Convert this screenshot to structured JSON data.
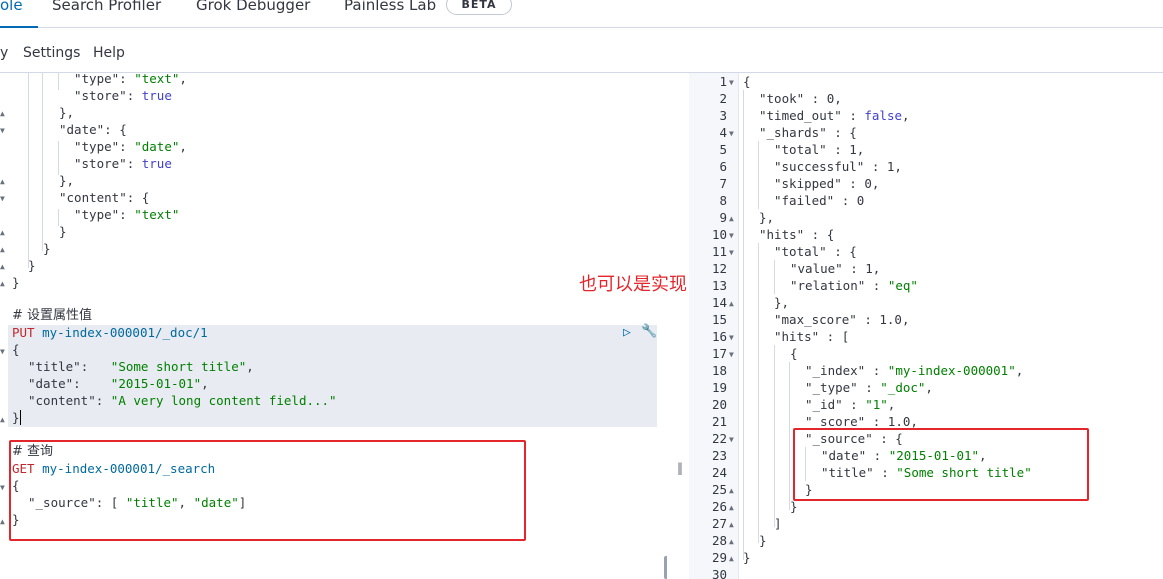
{
  "tabs": {
    "console": "ole",
    "search_profiler": "Search Profiler",
    "grok_debugger": "Grok Debugger",
    "painless_lab": "Painless Lab",
    "beta_badge": "BETA"
  },
  "menu": {
    "history": "y",
    "settings": "Settings",
    "help": "Help"
  },
  "accent_color": "#006bb4",
  "annotation_color": "#e3262b",
  "left_editor": {
    "lines": [
      {
        "a": "\"type\"",
        "b": ": ",
        "c": "\"text\"",
        "d": ","
      },
      {
        "a": "\"store\"",
        "b": ": ",
        "c": "true",
        "d": ""
      },
      {
        "a": "},",
        "b": "",
        "c": "",
        "d": ""
      },
      {
        "a": "\"date\"",
        "b": ": {",
        "c": "",
        "d": ""
      },
      {
        "a": "\"type\"",
        "b": ": ",
        "c": "\"date\"",
        "d": ","
      },
      {
        "a": "\"store\"",
        "b": ": ",
        "c": "true",
        "d": ""
      },
      {
        "a": "},",
        "b": "",
        "c": "",
        "d": ""
      },
      {
        "a": "\"content\"",
        "b": ": {",
        "c": "",
        "d": ""
      },
      {
        "a": "\"type\"",
        "b": ": ",
        "c": "\"text\"",
        "d": ""
      },
      {
        "a": "}",
        "b": "",
        "c": "",
        "d": ""
      },
      {
        "a": "}",
        "b": "",
        "c": "",
        "d": ""
      },
      {
        "a": "}",
        "b": "",
        "c": "",
        "d": ""
      },
      {
        "a": "}",
        "b": "",
        "c": "",
        "d": ""
      }
    ],
    "comment1": "# 设置属性值",
    "put_method": "PUT",
    "put_url": "my-index-000001/_doc/1",
    "body_open": "{",
    "title_key": "\"title\"",
    "title_sep": ":   ",
    "title_val": "\"Some short title\"",
    "date_key": "\"date\"",
    "date_sep": ":    ",
    "date_val": "\"2015-01-01\"",
    "content_key": "\"content\"",
    "content_sep": ": ",
    "content_val": "\"A very long content field...\"",
    "body_close": "}",
    "comment2": "# 查询",
    "get_method": "GET",
    "get_url": "my-index-000001/_search",
    "get_open": "{",
    "source_key": "\"_source\"",
    "source_sep": ": [ ",
    "source_v1": "\"title\"",
    "source_comma": ", ",
    "source_v2": "\"date\"",
    "source_end": "]",
    "get_close": "}"
  },
  "annotation_text": "也可以是实现",
  "right_editor": {
    "line_numbers": [
      "1",
      "2",
      "3",
      "4",
      "5",
      "6",
      "7",
      "8",
      "9",
      "10",
      "11",
      "12",
      "13",
      "14",
      "15",
      "16",
      "17",
      "18",
      "19",
      "20",
      "21",
      "22",
      "23",
      "24",
      "25",
      "26",
      "27",
      "28",
      "29",
      "30"
    ],
    "l1": "{",
    "l2k": "\"took\"",
    "l2v": "0",
    "l3k": "\"timed_out\"",
    "l3v": "false",
    "l4k": "\"_shards\"",
    "l5k": "\"total\"",
    "l5v": "1",
    "l6k": "\"successful\"",
    "l6v": "1",
    "l7k": "\"skipped\"",
    "l7v": "0",
    "l8k": "\"failed\"",
    "l8v": "0",
    "l9": "},",
    "l10k": "\"hits\"",
    "l11k": "\"total\"",
    "l12k": "\"value\"",
    "l12v": "1",
    "l13k": "\"relation\"",
    "l13v": "\"eq\"",
    "l14": "},",
    "l15k": "\"max_score\"",
    "l15v": "1.0",
    "l16k": "\"hits\"",
    "l17": "{",
    "l18k": "\"_index\"",
    "l18v": "\"my-index-000001\"",
    "l19k": "\"_type\"",
    "l19v": "\"_doc\"",
    "l20k": "\"_id\"",
    "l20v": "\"1\"",
    "l21k": "\"_score\"",
    "l21v": "1.0",
    "l22k": "\"_source\"",
    "l23k": "\"date\"",
    "l23v": "\"2015-01-01\"",
    "l24k": "\"title\"",
    "l24v": "\"Some short title\"",
    "l25": "}",
    "l26": "}",
    "l27": "]",
    "l28": "}",
    "l29": "}"
  }
}
